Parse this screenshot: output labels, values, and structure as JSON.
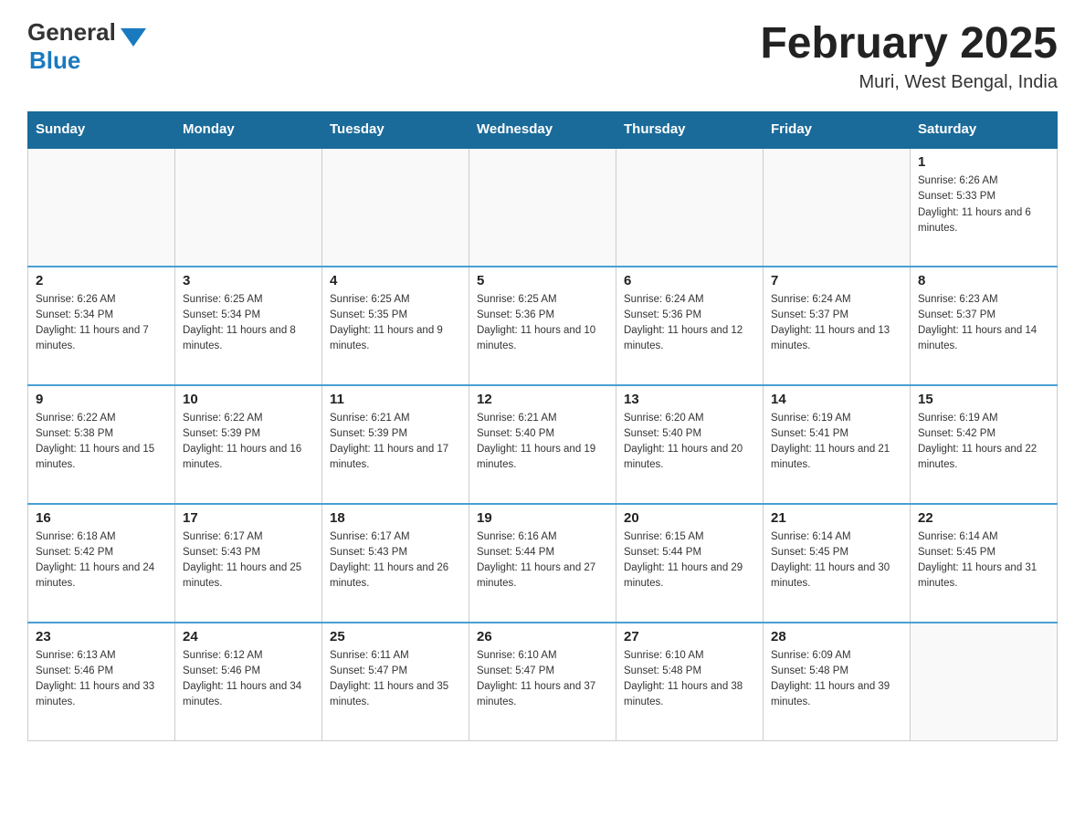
{
  "header": {
    "logo_general": "General",
    "logo_blue": "Blue",
    "month_title": "February 2025",
    "location": "Muri, West Bengal, India"
  },
  "weekdays": [
    "Sunday",
    "Monday",
    "Tuesday",
    "Wednesday",
    "Thursday",
    "Friday",
    "Saturday"
  ],
  "weeks": [
    [
      {
        "day": "",
        "info": ""
      },
      {
        "day": "",
        "info": ""
      },
      {
        "day": "",
        "info": ""
      },
      {
        "day": "",
        "info": ""
      },
      {
        "day": "",
        "info": ""
      },
      {
        "day": "",
        "info": ""
      },
      {
        "day": "1",
        "info": "Sunrise: 6:26 AM\nSunset: 5:33 PM\nDaylight: 11 hours and 6 minutes."
      }
    ],
    [
      {
        "day": "2",
        "info": "Sunrise: 6:26 AM\nSunset: 5:34 PM\nDaylight: 11 hours and 7 minutes."
      },
      {
        "day": "3",
        "info": "Sunrise: 6:25 AM\nSunset: 5:34 PM\nDaylight: 11 hours and 8 minutes."
      },
      {
        "day": "4",
        "info": "Sunrise: 6:25 AM\nSunset: 5:35 PM\nDaylight: 11 hours and 9 minutes."
      },
      {
        "day": "5",
        "info": "Sunrise: 6:25 AM\nSunset: 5:36 PM\nDaylight: 11 hours and 10 minutes."
      },
      {
        "day": "6",
        "info": "Sunrise: 6:24 AM\nSunset: 5:36 PM\nDaylight: 11 hours and 12 minutes."
      },
      {
        "day": "7",
        "info": "Sunrise: 6:24 AM\nSunset: 5:37 PM\nDaylight: 11 hours and 13 minutes."
      },
      {
        "day": "8",
        "info": "Sunrise: 6:23 AM\nSunset: 5:37 PM\nDaylight: 11 hours and 14 minutes."
      }
    ],
    [
      {
        "day": "9",
        "info": "Sunrise: 6:22 AM\nSunset: 5:38 PM\nDaylight: 11 hours and 15 minutes."
      },
      {
        "day": "10",
        "info": "Sunrise: 6:22 AM\nSunset: 5:39 PM\nDaylight: 11 hours and 16 minutes."
      },
      {
        "day": "11",
        "info": "Sunrise: 6:21 AM\nSunset: 5:39 PM\nDaylight: 11 hours and 17 minutes."
      },
      {
        "day": "12",
        "info": "Sunrise: 6:21 AM\nSunset: 5:40 PM\nDaylight: 11 hours and 19 minutes."
      },
      {
        "day": "13",
        "info": "Sunrise: 6:20 AM\nSunset: 5:40 PM\nDaylight: 11 hours and 20 minutes."
      },
      {
        "day": "14",
        "info": "Sunrise: 6:19 AM\nSunset: 5:41 PM\nDaylight: 11 hours and 21 minutes."
      },
      {
        "day": "15",
        "info": "Sunrise: 6:19 AM\nSunset: 5:42 PM\nDaylight: 11 hours and 22 minutes."
      }
    ],
    [
      {
        "day": "16",
        "info": "Sunrise: 6:18 AM\nSunset: 5:42 PM\nDaylight: 11 hours and 24 minutes."
      },
      {
        "day": "17",
        "info": "Sunrise: 6:17 AM\nSunset: 5:43 PM\nDaylight: 11 hours and 25 minutes."
      },
      {
        "day": "18",
        "info": "Sunrise: 6:17 AM\nSunset: 5:43 PM\nDaylight: 11 hours and 26 minutes."
      },
      {
        "day": "19",
        "info": "Sunrise: 6:16 AM\nSunset: 5:44 PM\nDaylight: 11 hours and 27 minutes."
      },
      {
        "day": "20",
        "info": "Sunrise: 6:15 AM\nSunset: 5:44 PM\nDaylight: 11 hours and 29 minutes."
      },
      {
        "day": "21",
        "info": "Sunrise: 6:14 AM\nSunset: 5:45 PM\nDaylight: 11 hours and 30 minutes."
      },
      {
        "day": "22",
        "info": "Sunrise: 6:14 AM\nSunset: 5:45 PM\nDaylight: 11 hours and 31 minutes."
      }
    ],
    [
      {
        "day": "23",
        "info": "Sunrise: 6:13 AM\nSunset: 5:46 PM\nDaylight: 11 hours and 33 minutes."
      },
      {
        "day": "24",
        "info": "Sunrise: 6:12 AM\nSunset: 5:46 PM\nDaylight: 11 hours and 34 minutes."
      },
      {
        "day": "25",
        "info": "Sunrise: 6:11 AM\nSunset: 5:47 PM\nDaylight: 11 hours and 35 minutes."
      },
      {
        "day": "26",
        "info": "Sunrise: 6:10 AM\nSunset: 5:47 PM\nDaylight: 11 hours and 37 minutes."
      },
      {
        "day": "27",
        "info": "Sunrise: 6:10 AM\nSunset: 5:48 PM\nDaylight: 11 hours and 38 minutes."
      },
      {
        "day": "28",
        "info": "Sunrise: 6:09 AM\nSunset: 5:48 PM\nDaylight: 11 hours and 39 minutes."
      },
      {
        "day": "",
        "info": ""
      }
    ]
  ]
}
